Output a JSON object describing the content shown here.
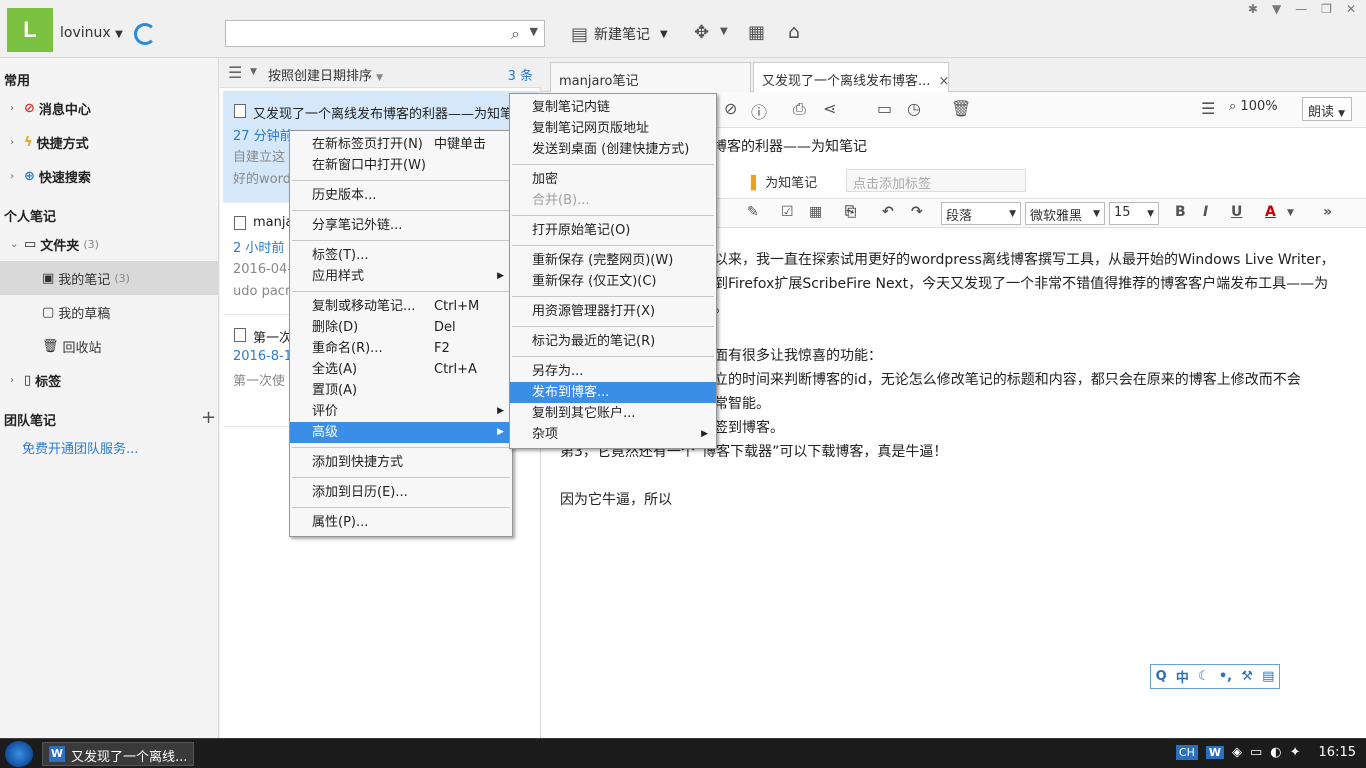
{
  "user": {
    "avatar_letter": "L",
    "name": "lovinux"
  },
  "toolbar": {
    "new_note": "新建笔记"
  },
  "sidebar": {
    "common_title": "常用",
    "common_items": [
      "消息中心",
      "快捷方式",
      "快速搜索"
    ],
    "personal_title": "个人笔记",
    "folder_label": "文件夹",
    "folder_count": "(3)",
    "sub_items": [
      {
        "label": "我的笔记",
        "count": "(3)"
      },
      {
        "label": "我的草稿",
        "count": ""
      },
      {
        "label": "回收站",
        "count": ""
      }
    ],
    "tags_label": "标签",
    "team_title": "团队笔记",
    "team_add": "+",
    "team_link": "免费开通团队服务..."
  },
  "list": {
    "sort_label": "按照创建日期排序",
    "count": "3 条",
    "notes": [
      {
        "title": "又发现了一个离线发布博客的利器——为知笔",
        "time": "27 分钟前",
        "snippet_1": "自建立这",
        "snippet_2": "好的word"
      },
      {
        "title": "manja",
        "time": "2 小时前",
        "snippet_1": "2016-04-",
        "snippet_2": "udo pacm"
      },
      {
        "title": "第一次",
        "time": "2016-8-1",
        "snippet_1": "第一次使",
        "snippet_2": ""
      }
    ]
  },
  "editor": {
    "tab1": "manjaro笔记",
    "tab2": "又发现了一个离线发布博客...",
    "tab_close": "×",
    "zoom": "100%",
    "read_button": "朗读",
    "doc_title": "搏客的利器——为知笔记",
    "notebook": "为知笔记",
    "tag_placeholder": "点击添加标签",
    "format": {
      "paragraph": "段落",
      "font": "微软雅黑",
      "size": "15"
    },
    "body": [
      "以来，我一直在探索试用更好的wordpress离线博客撰写工具，从最开始的Windows Live Writer，",
      "到Firefox扩展ScribeFire Next，今天又发现了一个非常不错值得推荐的博客客户端发布工具——为",
      "。",
      "",
      "面有很多让我惊喜的功能：",
      "立的时间来判断博客的id，无论怎么修改笔记的标题和内容，都只会在原来的博客上修改而不会",
      "常智能。",
      "签到博客。",
      "第3，它竟然还有一个“博客下载器”可以下载博客，真是牛逼！",
      "",
      "因为它牛逼，所以"
    ]
  },
  "context_menu": {
    "items": [
      {
        "label": "在新标签页打开(N)",
        "shortcut": "中键单击"
      },
      {
        "label": "在新窗口中打开(W)",
        "shortcut": ""
      },
      {
        "sep": true
      },
      {
        "label": "历史版本...",
        "shortcut": ""
      },
      {
        "sep": true
      },
      {
        "label": "分享笔记外链...",
        "shortcut": ""
      },
      {
        "sep": true
      },
      {
        "label": "标签(T)...",
        "shortcut": ""
      },
      {
        "label": "应用样式",
        "shortcut": "",
        "submenu": true
      },
      {
        "sep": true
      },
      {
        "label": "复制或移动笔记...",
        "shortcut": "Ctrl+M"
      },
      {
        "label": "删除(D)",
        "shortcut": "Del"
      },
      {
        "label": "重命名(R)...",
        "shortcut": "F2"
      },
      {
        "label": "全选(A)",
        "shortcut": "Ctrl+A"
      },
      {
        "label": "置顶(A)",
        "shortcut": ""
      },
      {
        "label": "评价",
        "shortcut": "",
        "submenu": true
      },
      {
        "label": "高级",
        "shortcut": "",
        "submenu": true,
        "highlighted": true
      },
      {
        "sep": true
      },
      {
        "label": "添加到快捷方式",
        "shortcut": ""
      },
      {
        "sep": true
      },
      {
        "label": "添加到日历(E)...",
        "shortcut": ""
      },
      {
        "sep": true
      },
      {
        "label": "属性(P)...",
        "shortcut": ""
      }
    ]
  },
  "submenu": {
    "items": [
      {
        "label": "复制笔记内链"
      },
      {
        "label": "复制笔记网页版地址"
      },
      {
        "label": "发送到桌面 (创建快捷方式)"
      },
      {
        "sep": true
      },
      {
        "label": "加密"
      },
      {
        "label": "合并(B)...",
        "disabled": true
      },
      {
        "sep": true
      },
      {
        "label": "打开原始笔记(O)"
      },
      {
        "sep": true
      },
      {
        "label": "重新保存 (完整网页)(W)"
      },
      {
        "label": "重新保存 (仅正文)(C)"
      },
      {
        "sep": true
      },
      {
        "label": "用资源管理器打开(X)"
      },
      {
        "sep": true
      },
      {
        "label": "标记为最近的笔记(R)"
      },
      {
        "sep": true
      },
      {
        "label": "另存为..."
      },
      {
        "label": "发布到博客...",
        "highlighted": true
      },
      {
        "label": "复制到其它账户..."
      },
      {
        "label": "杂项",
        "submenu": true
      }
    ]
  },
  "ime": {
    "zh": "中"
  },
  "taskbar": {
    "item": "又发现了一个离线...",
    "lang": "CH",
    "time": "16:15"
  }
}
